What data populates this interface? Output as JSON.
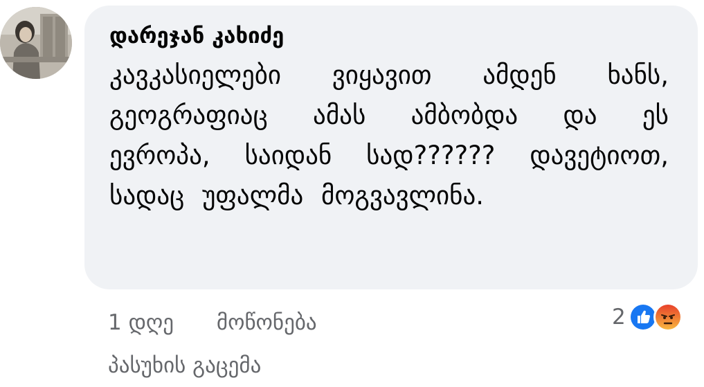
{
  "comment": {
    "author": "დარეჯან კახიძე",
    "text": "კავკასიელები ვიყავით ამდენ ხანს, გეოგრაფიაც ამას ამბობდა და ეს ევროპა, საიდან სად?????? დავეტიოთ, სადაც უფალმა მოგვავლინა.",
    "avatar_icon": "profile-photo"
  },
  "actions": {
    "time": "1 დღე",
    "like_label": "მოწონება",
    "reply_label": "პასუხის გაცემა"
  },
  "reactions": {
    "count": "2",
    "icons": [
      "like-icon",
      "angry-icon"
    ],
    "colors": {
      "like": "#1877f2",
      "angry": "#f56a1a"
    }
  }
}
